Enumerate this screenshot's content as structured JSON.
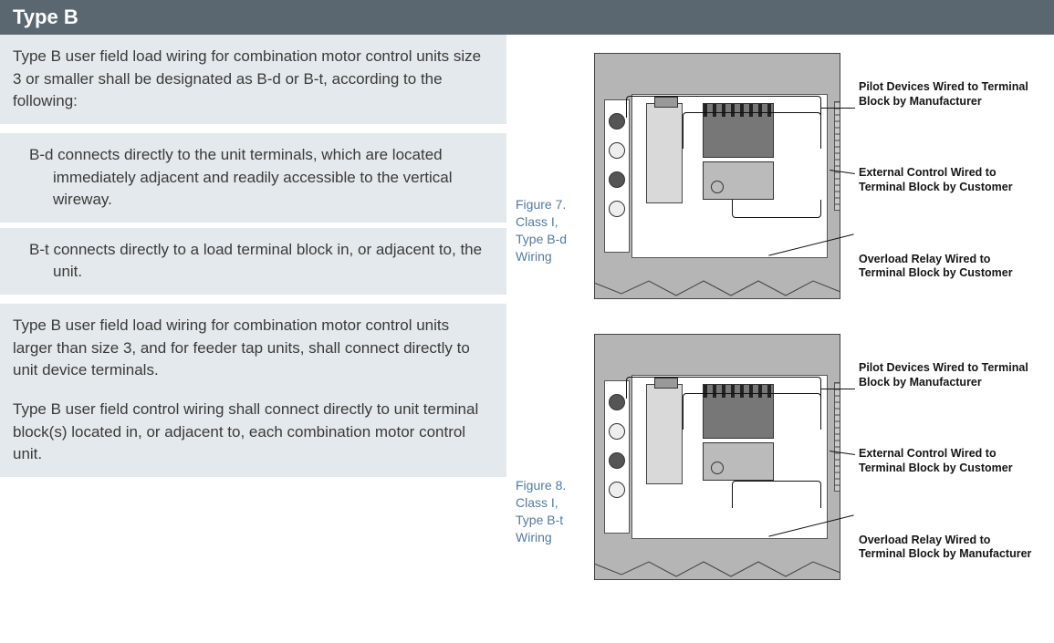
{
  "header": {
    "title": "Type B"
  },
  "left": {
    "intro": "Type B user field load wiring for combination motor control units size 3 or smaller shall be designated as B-d or B-t, according to the following:",
    "bd": "B-d connects directly to the unit terminals, which are located immediately adjacent and readily accessible to the vertical wireway.",
    "bt": "B-t connects directly to a load terminal block in, or adjacent to, the unit.",
    "para1": "Type B user field load wiring for combination motor control units larger than size 3, and for feeder tap units, shall connect directly to unit device terminals.",
    "para2": "Type B user field control wiring shall connect directly to unit terminal block(s) located in, or adjacent to, each combination motor control unit."
  },
  "figures": [
    {
      "caption_l1": "Figure 7.",
      "caption_l2": "Class I,",
      "caption_l3": "Type B-d",
      "caption_l4": "Wiring",
      "labels": {
        "top": "Pilot Devices Wired to Terminal Block by Manufacturer",
        "mid": "External Control Wired to Terminal Block by Customer",
        "bot": "Overload Relay Wired to Terminal Block by Customer"
      }
    },
    {
      "caption_l1": "Figure 8.",
      "caption_l2": "Class I,",
      "caption_l3": "Type B-t",
      "caption_l4": "Wiring",
      "labels": {
        "top": "Pilot Devices Wired to Terminal Block by Manufacturer",
        "mid": "External Control Wired to Terminal Block by Customer",
        "bot": "Overload Relay Wired to Terminal Block by Manufacturer"
      }
    }
  ]
}
